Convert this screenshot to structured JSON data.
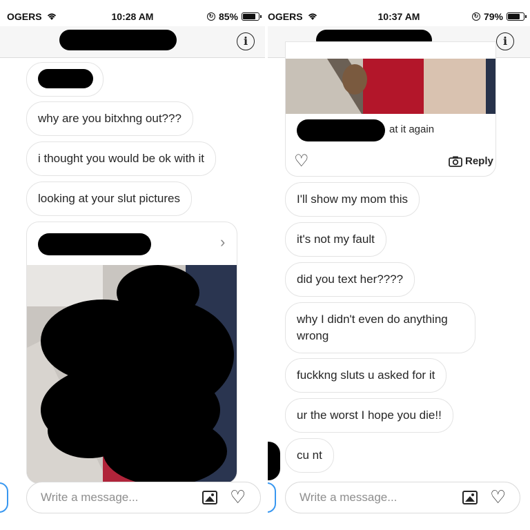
{
  "left": {
    "status": {
      "carrier": "OGERS",
      "time": "10:28 AM",
      "battery": "85%",
      "battery_level": 0.85
    },
    "messages": [
      {
        "text": "why are you bitxhng out???"
      },
      {
        "text": "i thought you would be ok with it"
      },
      {
        "text": "looking at your slut pictures"
      }
    ],
    "composer": {
      "placeholder": "Write a message..."
    }
  },
  "right": {
    "status": {
      "carrier": "OGERS",
      "time": "10:37 AM",
      "battery": "79%",
      "battery_level": 0.79
    },
    "post": {
      "caption_suffix": "at it again",
      "reply_label": "Reply"
    },
    "messages": [
      {
        "text": "I'll show my mom this"
      },
      {
        "text": "it's not my fault"
      },
      {
        "text": "did you text her????"
      },
      {
        "text": "why I didn't even do anything wrong"
      },
      {
        "text": "fuckkng sluts u asked for it"
      },
      {
        "text": "ur the worst I hope you die!!"
      },
      {
        "text": "cu nt"
      }
    ],
    "composer": {
      "placeholder": "Write a message..."
    }
  },
  "icons": {
    "wifi": "wifi-icon",
    "info": "info-icon",
    "heart": "heart-icon",
    "camera": "camera-icon",
    "gallery": "gallery-icon",
    "chevron": "chevron-right-icon"
  },
  "colors": {
    "accent": "#3897f0",
    "bubble_border": "#e3e3e3",
    "placeholder": "#8e8e8e"
  }
}
